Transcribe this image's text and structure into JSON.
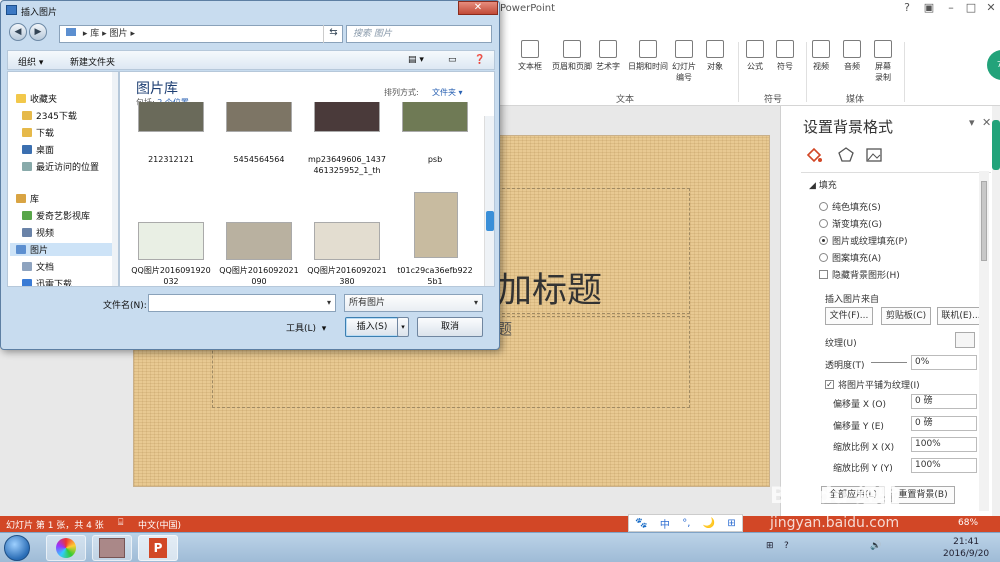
{
  "ppt": {
    "app_title": "PowerPoint",
    "controls": [
      "?",
      "▣",
      "–",
      "□",
      "✕"
    ],
    "ribbon_items": [
      {
        "label": "文本框",
        "icon": "text-box-icon"
      },
      {
        "label": "页眉和页脚",
        "icon": "header-footer-icon"
      },
      {
        "label": "艺术字",
        "icon": "wordart-icon"
      },
      {
        "label": "日期和时间",
        "icon": "date-time-icon"
      },
      {
        "label": "幻灯片\n编号",
        "icon": "slide-number-icon"
      },
      {
        "label": "对象",
        "icon": "object-icon"
      },
      {
        "label": "公式",
        "icon": "equation-icon"
      },
      {
        "label": "符号",
        "icon": "symbol-icon"
      },
      {
        "label": "视频",
        "icon": "video-icon"
      },
      {
        "label": "音频",
        "icon": "audio-icon"
      },
      {
        "label": "屏幕\n录制",
        "icon": "screen-record-icon"
      }
    ],
    "ribbon_groups": [
      "文本",
      "符号",
      "媒体"
    ],
    "user_badge": "74",
    "slide_title": "加标题",
    "slide_subtitle": "题"
  },
  "format_pane": {
    "title": "设置背景格式",
    "section_fill": "填充",
    "fill_options": [
      {
        "label": "纯色填充(S)",
        "selected": false
      },
      {
        "label": "渐变填充(G)",
        "selected": false
      },
      {
        "label": "图片或纹理填充(P)",
        "selected": true
      },
      {
        "label": "图案填充(A)",
        "selected": false
      }
    ],
    "hide_bg_label": "隐藏背景图形(H)",
    "insert_from": "插入图片来自",
    "buttons": [
      "文件(F)...",
      "剪贴板(C)",
      "联机(E)..."
    ],
    "texture_label": "纹理(U)",
    "transparency_label": "透明度(T)",
    "transparency_value": "0%",
    "tile_label": "将图片平铺为纹理(I)",
    "offset_x_label": "偏移量 X (O)",
    "offset_x_value": "0 磅",
    "offset_y_label": "偏移量 Y (E)",
    "offset_y_value": "0 磅",
    "scale_x_label": "缩放比例 X (X)",
    "scale_x_value": "100%",
    "scale_y_label": "缩放比例 Y (Y)",
    "scale_y_value": "100%",
    "bottom_buttons": [
      "全部应用(L)",
      "重置背景(B)"
    ]
  },
  "status_bar": {
    "slide_info": "幻灯片 第 1 张，共 4 张",
    "language": "中文(中国)",
    "zoom": "68%"
  },
  "ime": [
    "中",
    "°,",
    "🌙",
    "⊞"
  ],
  "taskbar": {
    "time": "21:41",
    "date": "2016/9/20"
  },
  "watermark": {
    "top": "Bai du 经验",
    "bottom": "jingyan.baidu.com"
  },
  "dialog": {
    "title": "插入图片",
    "address": [
      "库",
      "图片"
    ],
    "search_placeholder": "搜索 图片",
    "toolbar_organize": "组织 ▾",
    "toolbar_new_folder": "新建文件夹",
    "nav": [
      {
        "label": "收藏夹",
        "color": "#f2c84b",
        "indent": false
      },
      {
        "label": "2345下载",
        "color": "#e6b94a",
        "indent": true
      },
      {
        "label": "下载",
        "color": "#e6b94a",
        "indent": true
      },
      {
        "label": "桌面",
        "color": "#3b6fb0",
        "indent": true
      },
      {
        "label": "最近访问的位置",
        "color": "#8aa",
        "indent": true
      },
      {
        "label": "库",
        "color": "#d9a443",
        "indent": false
      },
      {
        "label": "爱奇艺影视库",
        "color": "#58a64a",
        "indent": true
      },
      {
        "label": "视频",
        "color": "#6a83a8",
        "indent": true
      },
      {
        "label": "图片",
        "color": "#5c8fd0",
        "indent": true,
        "selected": true
      },
      {
        "label": "文档",
        "color": "#8ea3bf",
        "indent": true
      },
      {
        "label": "迅雷下载",
        "color": "#3a7bd5",
        "indent": true
      }
    ],
    "library_title": "图片库",
    "library_sub_prefix": "包括: ",
    "library_sub_link": "2 个位置",
    "sort_label": "排列方式:",
    "sort_value": "文件夹 ▾",
    "files": [
      {
        "caption": "212312121",
        "color": "#6a6a5a"
      },
      {
        "caption": "5454564564",
        "color": "#7d7565"
      },
      {
        "caption": "mp23649606_1437461325952_1_th",
        "color": "#4a3a3a"
      },
      {
        "caption": "psb",
        "color": "#6f7a55"
      },
      {
        "caption": "QQ图片2016091920032",
        "color": "#e9efe4"
      },
      {
        "caption": "QQ图片2016092021090",
        "color": "#b9b1a0"
      },
      {
        "caption": "QQ图片2016092021380",
        "color": "#e3ddd0"
      },
      {
        "caption": "t01c29ca36efb9225b1",
        "color": "#c8bba0"
      }
    ],
    "filename_label": "文件名(N):",
    "filename_value": "",
    "filetype_value": "所有图片",
    "tools_label": "工具(L)",
    "insert_label": "插入(S)",
    "cancel_label": "取消"
  }
}
